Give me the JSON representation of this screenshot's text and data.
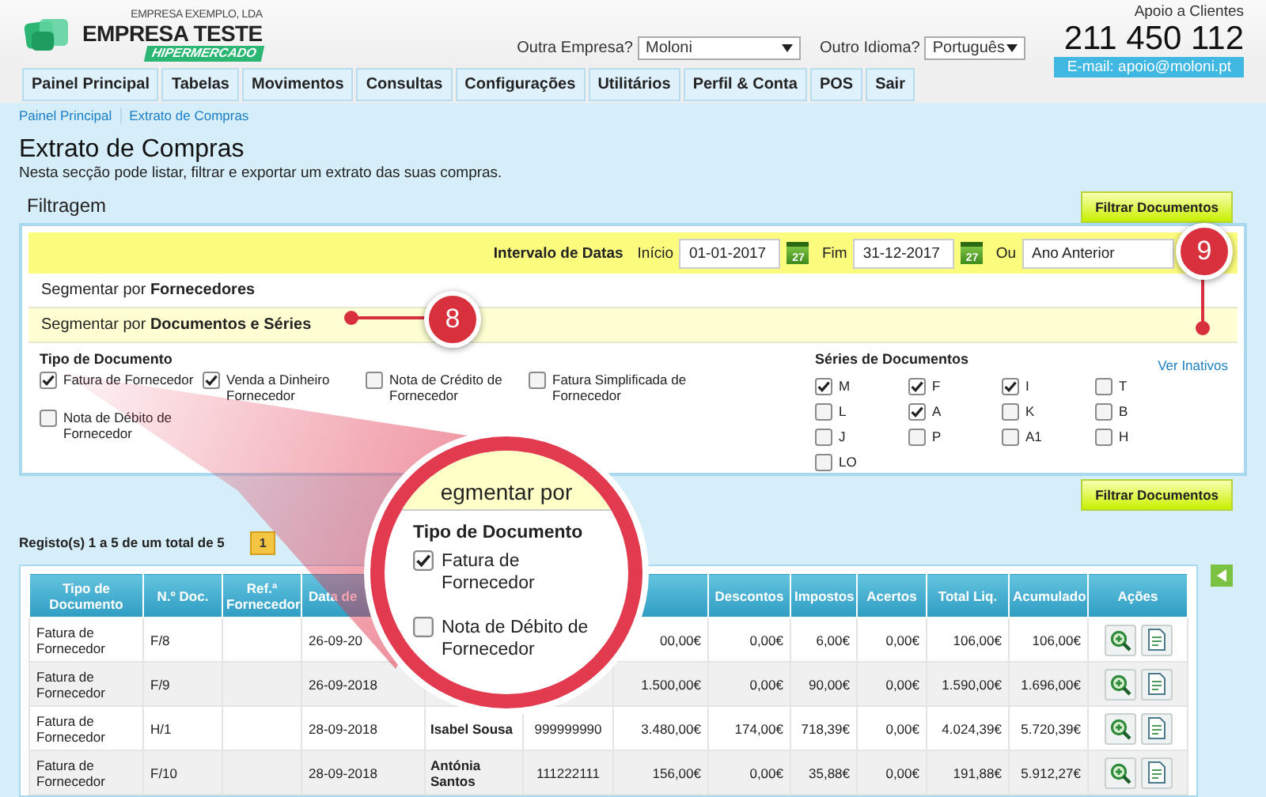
{
  "header": {
    "company_caption": "EMPRESA EXEMPLO, LDA",
    "company": "EMPRESA TESTE",
    "badge": "HIPERMERCADO",
    "company_select": {
      "label": "Outra Empresa?",
      "value": "Moloni"
    },
    "language_select": {
      "label": "Outro Idioma?",
      "value": "Português"
    },
    "support": {
      "label": "Apoio a Clientes",
      "phone": "211 450 112",
      "email": "E-mail: apoio@moloni.pt"
    }
  },
  "nav": [
    {
      "label": "Painel Principal",
      "selected": false
    },
    {
      "label": "Tabelas",
      "selected": false
    },
    {
      "label": "Movimentos",
      "selected": false
    },
    {
      "label": "Consultas",
      "selected": false
    },
    {
      "label": "Configurações",
      "selected": false
    },
    {
      "label": "Utilitários",
      "selected": false
    },
    {
      "label": "Perfil & Conta",
      "selected": false
    },
    {
      "label": "POS",
      "selected": false
    },
    {
      "label": "Sair",
      "selected": false
    }
  ],
  "breadcrumbs": [
    "Painel Principal",
    "Extrato de Compras"
  ],
  "page": {
    "title": "Extrato de Compras",
    "description": "Nesta secção pode listar, filtrar e exportar um extrato das suas compras."
  },
  "filter": {
    "title": "Filtragem",
    "button": "Filtrar Documentos",
    "dates": {
      "label": "Intervalo de Datas",
      "start_label": "Início",
      "start": "01-01-2017",
      "start_calendar": "27",
      "end_label": "Fim",
      "end": "31-12-2017",
      "end_calendar": "27",
      "or_label": "Ou",
      "period": "Ano Anterior"
    },
    "sections": [
      {
        "text": "Segmentar por **Fornecedores**",
        "expanded": false
      },
      {
        "text": "Segmentar por **Documentos e Séries**",
        "expanded": true
      }
    ],
    "doc_types": {
      "title": "Tipo de Documento",
      "items": [
        {
          "label": "Fatura de Fornecedor",
          "checked": true
        },
        {
          "label": "Venda a Dinheiro Fornecedor",
          "checked": true
        },
        {
          "label": "Nota de Crédito de Fornecedor",
          "checked": false
        },
        {
          "label": "Fatura Simplificada de Fornecedor",
          "checked": false
        },
        {
          "label": "Nota de Débito de Fornecedor",
          "checked": false
        }
      ]
    },
    "series": {
      "title": "Séries de Documentos",
      "link": "Ver Inativos",
      "items": [
        {
          "label": "M",
          "checked": true
        },
        {
          "label": "F",
          "checked": true
        },
        {
          "label": "I",
          "checked": true
        },
        {
          "label": "T",
          "checked": false
        },
        {
          "label": "L",
          "checked": false
        },
        {
          "label": "A",
          "checked": true
        },
        {
          "label": "K",
          "checked": false
        },
        {
          "label": "B",
          "checked": false
        },
        {
          "label": "J",
          "checked": false
        },
        {
          "label": "P",
          "checked": false
        },
        {
          "label": "A1",
          "checked": false
        },
        {
          "label": "H",
          "checked": false
        },
        {
          "label": "LO",
          "checked": false
        }
      ]
    },
    "bottom_button": "Filtrar Documentos"
  },
  "results": {
    "summary": "Registo(s) 1 a 5 de um total de 5",
    "pages": [
      {
        "label": "1",
        "selected": true
      }
    ],
    "columns": [
      "Tipo de Documento",
      "N.º Doc.",
      "Ref.ª Fornecedor",
      "Data de",
      null,
      null,
      null,
      "Descontos",
      "Impostos",
      "Acertos",
      "Total Liq.",
      "Acumulado",
      "Ações"
    ],
    "rows": [
      [
        "Fatura de Fornecedor",
        "F/8",
        null,
        "26-09-20",
        null,
        null,
        "00,00€",
        "0,00€",
        "6,00€",
        "0,00€",
        "106,00€",
        "106,00€"
      ],
      [
        "Fatura de Fornecedor",
        "F/9",
        null,
        "26-09-2018",
        null,
        null,
        "1.500,00€",
        "0,00€",
        "90,00€",
        "0,00€",
        "1.590,00€",
        "1.696,00€"
      ],
      [
        "Fatura de Fornecedor",
        "H/1",
        null,
        "28-09-2018",
        "Isabel Sousa",
        "999999990",
        "3.480,00€",
        "174,00€",
        "718,39€",
        "0,00€",
        "4.024,39€",
        "5.720,39€"
      ],
      [
        "Fatura de Fornecedor",
        "F/10",
        null,
        "28-09-2018",
        "Antónia Santos",
        "111222111",
        "156,00€",
        "0,00€",
        "35,88€",
        "0,00€",
        "191,88€",
        "5.912,27€"
      ]
    ]
  },
  "callouts": [
    "8",
    "9"
  ],
  "magnifier": {
    "band": "egmentar por",
    "title": "Tipo de Documento",
    "items": [
      {
        "label": "Fatura de Fornecedor",
        "checked": true
      },
      {
        "label": "Nota de Débito de Fornecedor",
        "checked": false
      }
    ]
  }
}
